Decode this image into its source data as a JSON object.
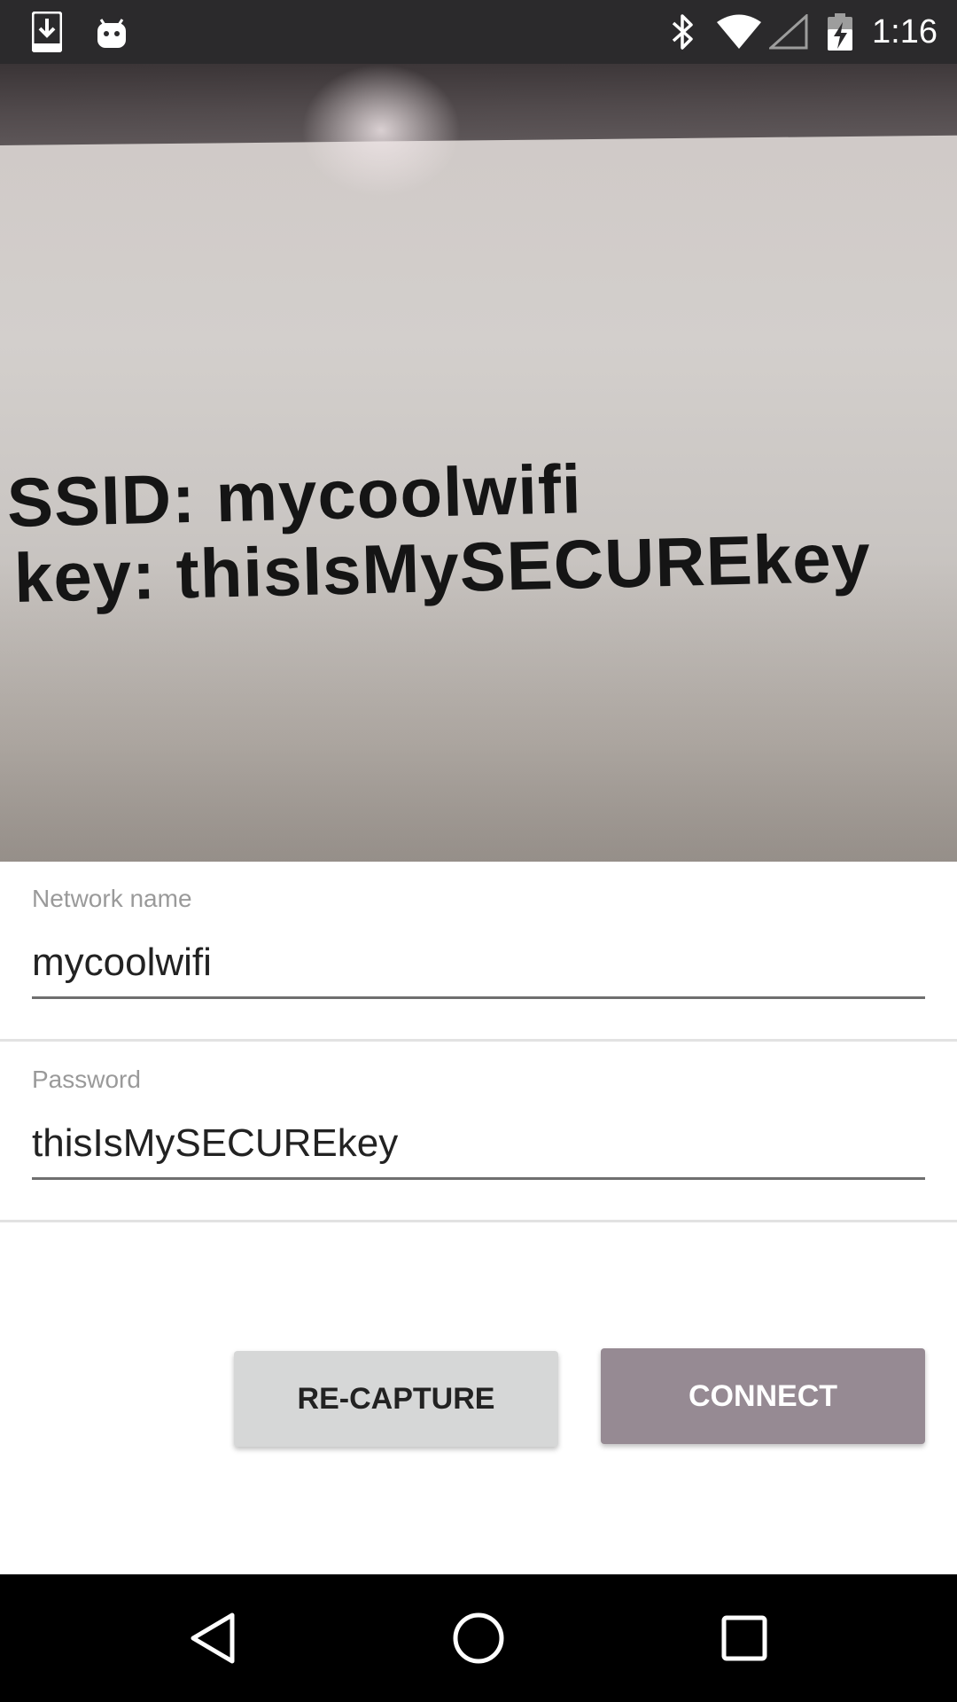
{
  "status_bar": {
    "time": "1:16",
    "icons": [
      "download-icon",
      "android-icon",
      "bluetooth-icon",
      "wifi-icon",
      "cell-signal-icon",
      "battery-charging-icon"
    ]
  },
  "photo": {
    "line1": "SSID: mycoolwifi",
    "line2": "key: thisIsMySECUREkey"
  },
  "form": {
    "network_name_label": "Network name",
    "network_name_value": "mycoolwifi",
    "password_label": "Password",
    "password_value": "thisIsMySECUREkey"
  },
  "buttons": {
    "recapture_label": "RE-CAPTURE",
    "connect_label": "CONNECT"
  },
  "nav_bar": {
    "icons": [
      "back-icon",
      "home-icon",
      "recents-icon"
    ]
  },
  "colors": {
    "status_bar": "#2b2a2c",
    "connect_button": "#968a93",
    "recapture_button": "#d6d7d7",
    "nav_bar": "#000000"
  }
}
